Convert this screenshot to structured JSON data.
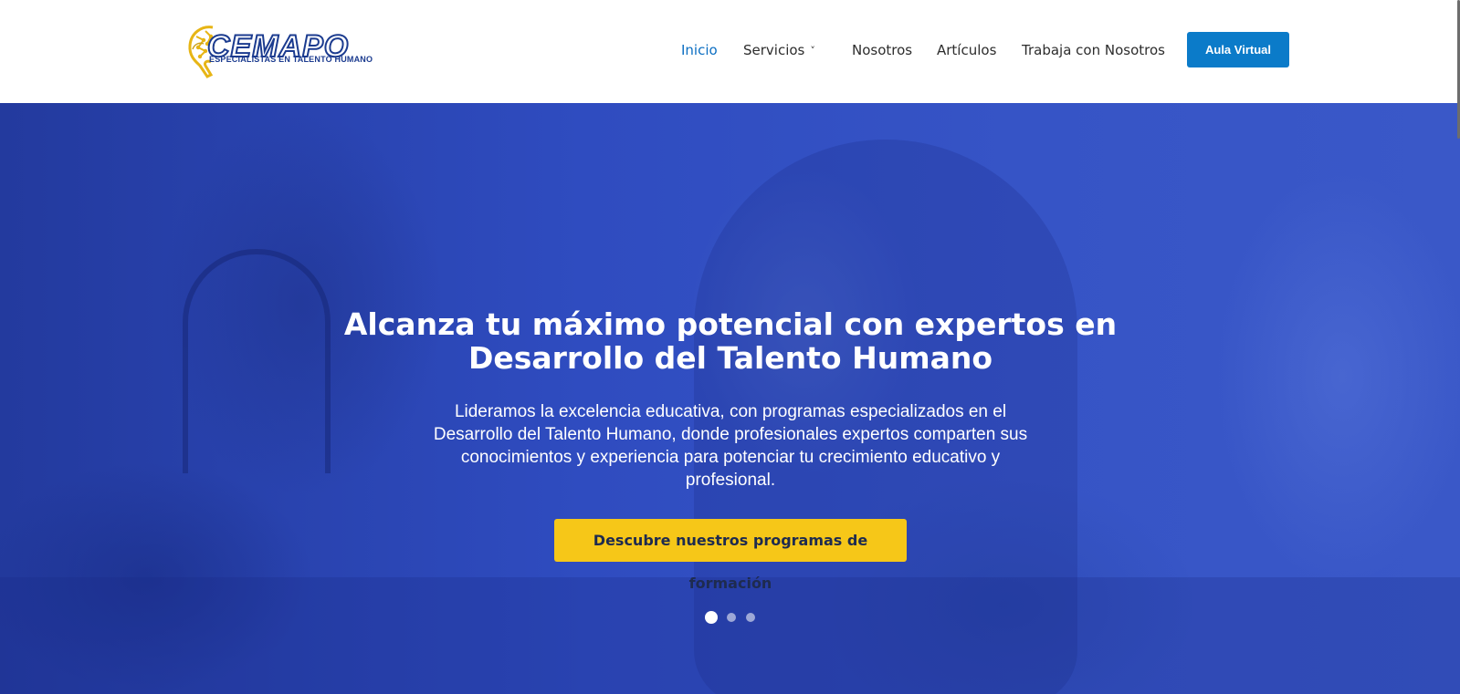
{
  "brand": {
    "name": "CEMAPO",
    "tagline": "ESPECIALISTAS EN TALENTO HUMANO"
  },
  "nav": {
    "items": [
      {
        "label": "Inicio",
        "active": true
      },
      {
        "label": "Servicios",
        "has_dropdown": true
      },
      {
        "label": "Nosotros"
      },
      {
        "label": "Artículos"
      },
      {
        "label": "Trabaja con Nosotros"
      }
    ],
    "cta_label": "Aula Virtual"
  },
  "hero": {
    "title_line1": "Alcanza tu máximo potencial con expertos en",
    "title_line2": "Desarrollo del Talento Humano",
    "text_line1": "Lideramos la excelencia educativa, con programas especializados en el",
    "text_line2": "Desarrollo del Talento Humano, donde profesionales expertos comparten sus",
    "text_line3": "conocimientos y experiencia para potenciar tu crecimiento educativo y",
    "text_line4": "profesional.",
    "cta_label": "Descubre nuestros programas de formación",
    "slides_total": 3,
    "slide_active": 1
  },
  "colors": {
    "accent": "#0b7bc9",
    "nav_active": "#0b6ec2",
    "hero_overlay": "#2f4cc0",
    "cta_yellow": "#f6c718",
    "brand_navy": "#1b3b8f",
    "brand_gold": "#e7b515"
  },
  "icons": {
    "logo": "brain-circuit-logo",
    "dropdown": "chevron-down-icon"
  }
}
